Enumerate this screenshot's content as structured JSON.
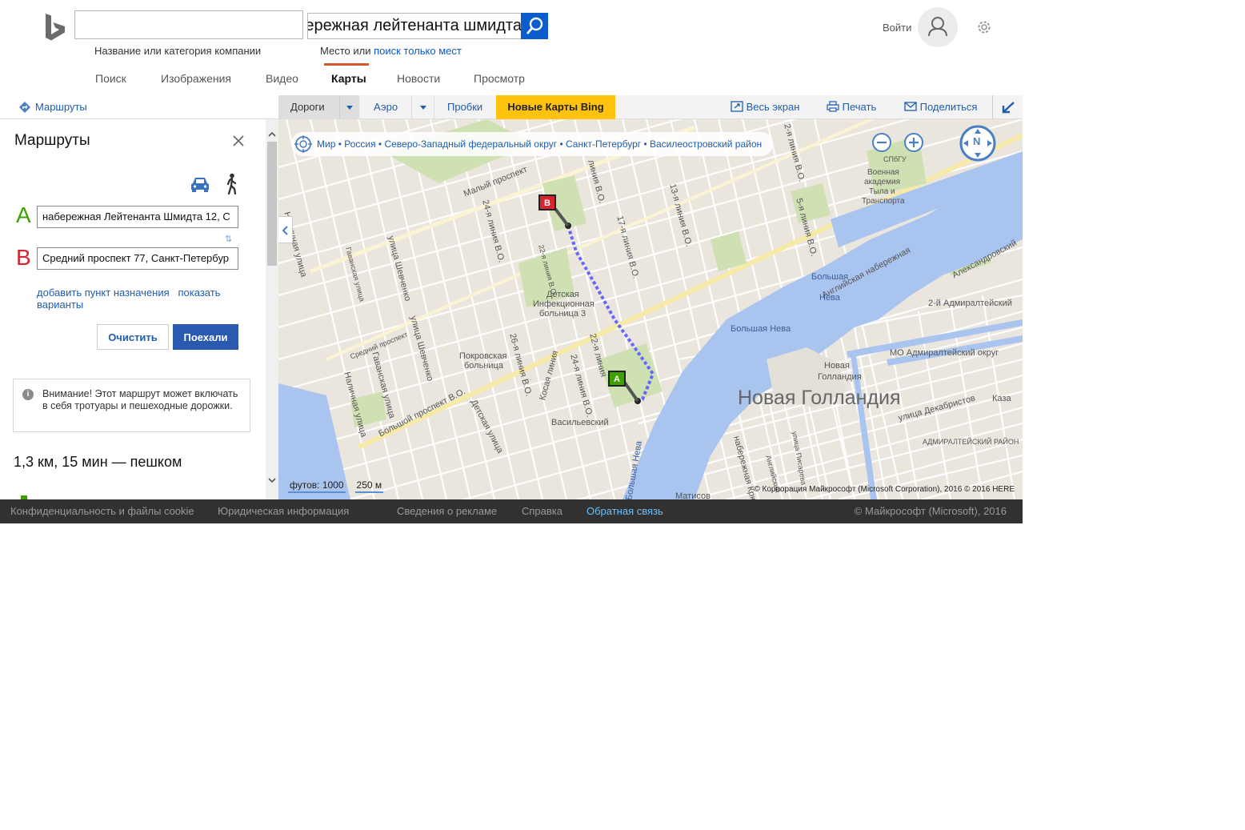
{
  "header": {
    "business_placeholder": "",
    "business_label": "Название или категория компании",
    "place_value": "набережная лейтенанта шмидта",
    "place_label_prefix": "Место или",
    "place_label_link": "поиск только мест",
    "signin": "Войти"
  },
  "nav": [
    "Поиск",
    "Изображения",
    "Видео",
    "Карты",
    "Новости",
    "Просмотр"
  ],
  "nav_active": "Карты",
  "subbar": {
    "routes_link": "Маршруты",
    "roads": "Дороги",
    "aero": "Аэро",
    "traffic": "Пробки",
    "new_maps": "Новые Карты Bing",
    "fullscreen": "Весь экран",
    "print": "Печать",
    "share": "Поделиться"
  },
  "panel": {
    "title": "Маршруты",
    "point_a_letter": "A",
    "point_b_letter": "B",
    "point_a_value": "набережная Лейтенанта Шмидта 12, С",
    "point_b_value": "Средний проспект 77, Санкт-Петербур",
    "add_destination": "добавить пункт назначения",
    "show_options": "показать варианты",
    "clear_button": "Очистить",
    "go_button": "Поехали",
    "notice": "Внимание! Этот маршрут может включать в себя тротуары и пешеходные дорожки.",
    "notice_icon": "i",
    "summary": "1,3 км, 15 мин — пешком"
  },
  "map": {
    "breadcrumb": "Мир • Россия • Северо-Западный федеральный округ • Санкт-Петербург • Василеостровский район",
    "compass_label": "N",
    "pin_a": "A",
    "pin_b": "B",
    "labels": {
      "novaya_gollandiya_big": "Новая Голландия",
      "bolshaya_neva": "Большая Нева",
      "bolshaya_neva_upper": "Большая",
      "neva": "Нева",
      "angliyskaya": "Английская набережная",
      "admiralteyskiy_2": "2-й Адмиралтейский",
      "mo_admiralteyskiy": "МО Адмиралтейский округ",
      "novaya_gollandiya_small_1": "Новая",
      "novaya_gollandiya_small_2": "Голландия",
      "vasilevskiy": "Васильевский",
      "detskaya_1": "Детская",
      "detskaya_2": "Инфекционная",
      "detskaya_3": "больница 3",
      "pokrovskaya_1": "Покровская",
      "pokrovskaya_2": "больница",
      "academy_1": "Военная",
      "academy_2": "академия",
      "academy_3": "Тыла и",
      "academy_4": "Транспорта",
      "spbgu": "СПбГУ",
      "bolshoy_prospekt": "Большой проспект В.О.",
      "maly_prospekt": "Малый проспект",
      "sredniy_prospekt": "Средний проспект",
      "nalichnaya_1": "Наличная улица",
      "nalichnaya_2": "Наличная улица",
      "shevchenko_1": "улица Шевченко",
      "shevchenko_2": "улица Шевченко",
      "gavanskaya_1": "Гаванская улица",
      "gavanskaya_2": "Гаванская улица",
      "detskaya_ul": "Детская улица",
      "kosaya": "Косая линия",
      "liniya_24": "24-я линия В.О.",
      "liniya_22": "22-я линия В.О.",
      "liniya_22b": "22-я линия",
      "liniya_26": "26-я линия В.О.",
      "liniya_24b": "24-я линия В.О.",
      "liniya_17": "17-я линия В.О.",
      "liniya_13": "13-я линия В.О.",
      "liniya_5": "5-я линия В.О.",
      "liniya_2": "2-я линия В.О.",
      "liniya_16": "линия В.О.",
      "ulitsa_dekabristov": "улица Декабристов",
      "admiralteyskiy_rayon": "АДМИРАЛТЕЙСКИЙ РАЙОН",
      "kaza": "Каза",
      "aleksandrovskiy": "Александровский",
      "matisov": "Матисов",
      "malaya_neva": "Большая Нева",
      "naberezhnaya_kryukova": "набережная Крюкова",
      "pisareva": "улица Писарева",
      "anglyskiy_pr": "Английский"
    },
    "scale_feet": "футов: 1000",
    "scale_m": "250 м",
    "copyright": "© Корпорация Майкрософт (Microsoft Corporation), 2016    © 2016 HERE"
  },
  "footer": {
    "privacy": "Конфиденциальность и файлы cookie",
    "legal": "Юридическая информация",
    "ads": "Сведения о рекламе",
    "help": "Справка",
    "feedback": "Обратная связь",
    "copyright": "© Майкрософт (Microsoft), 2016"
  },
  "colors": {
    "accent": "#0c5dcc",
    "link": "#1f5dad",
    "new_maps_bg": "#ffc20e",
    "water": "#a9c4ee",
    "route": "#6666ff",
    "pin_a": "#3ea100",
    "pin_b": "#d9232d"
  }
}
